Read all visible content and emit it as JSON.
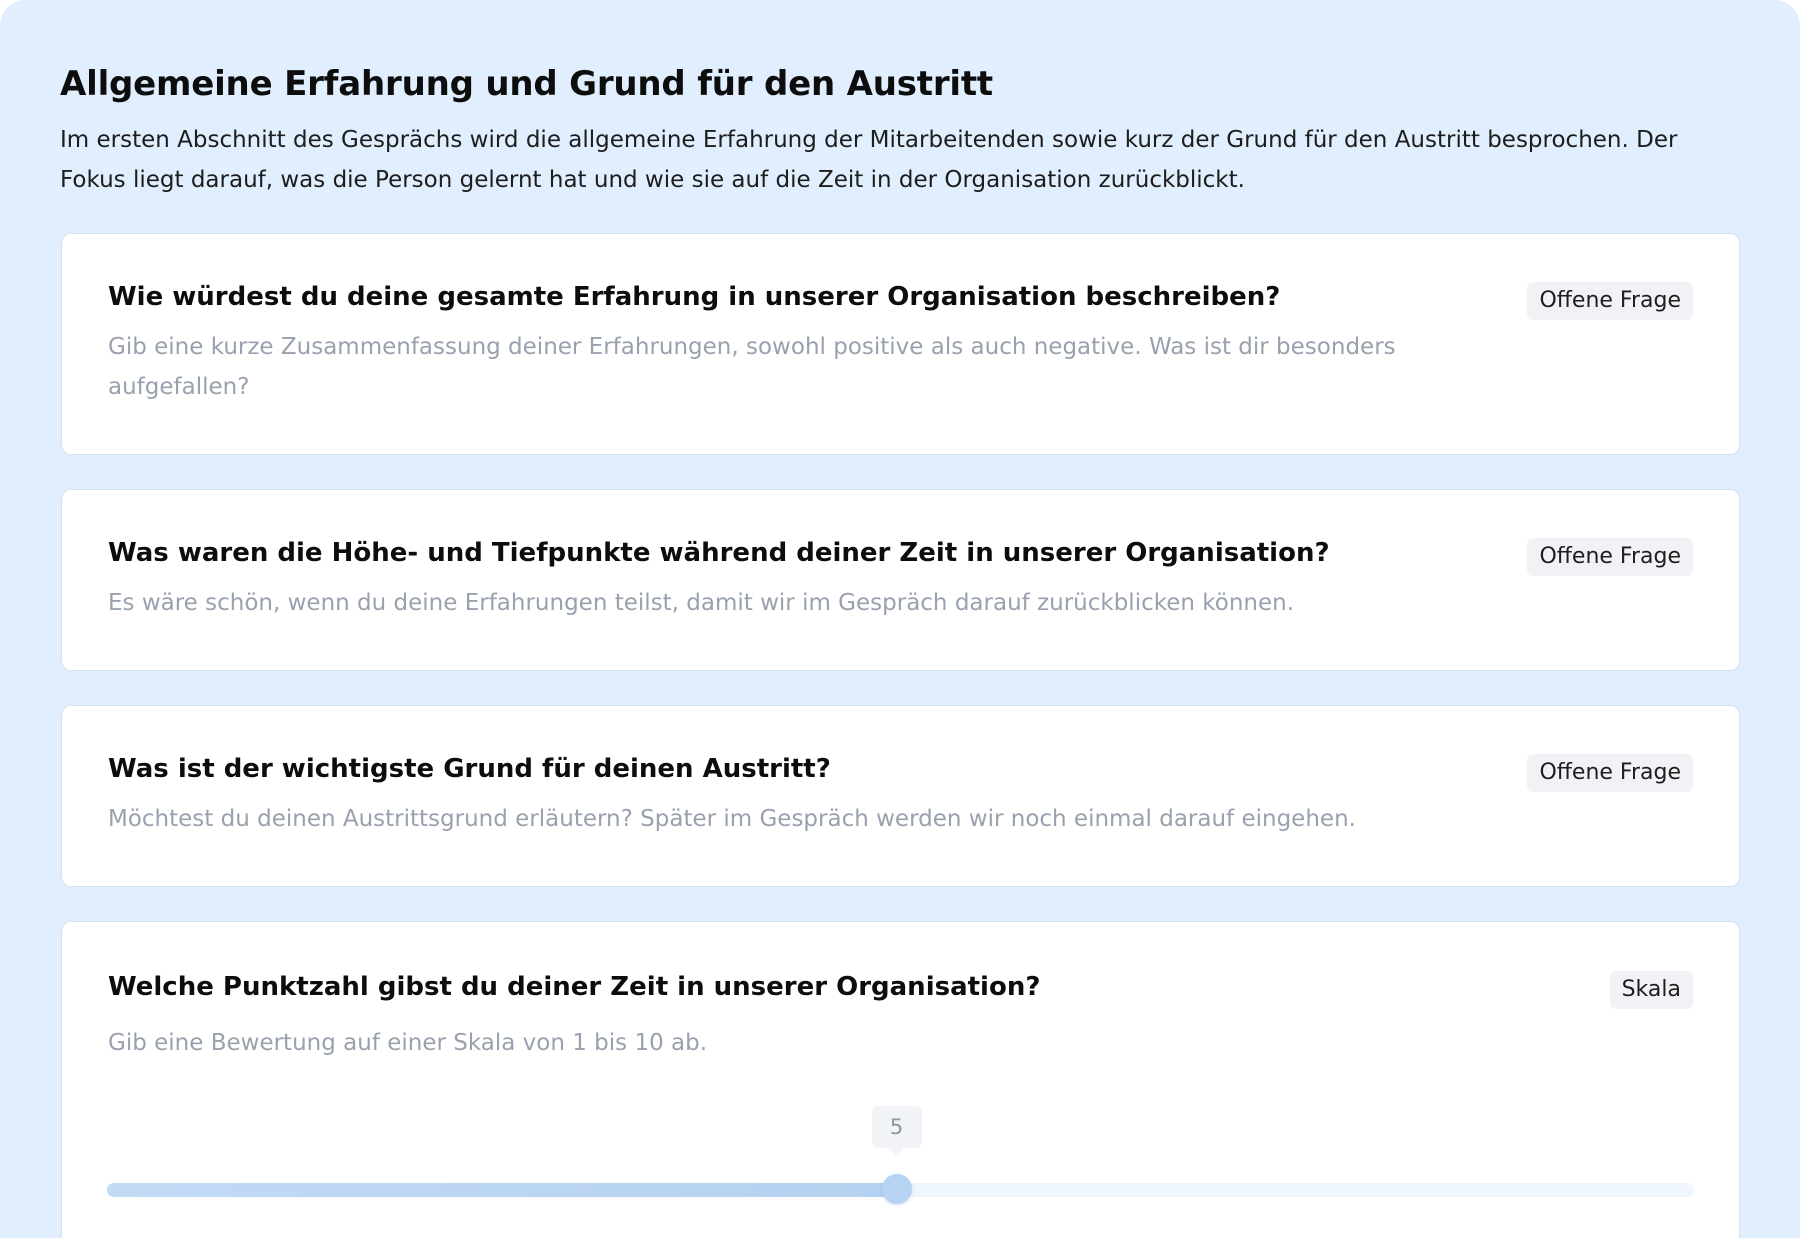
{
  "section": {
    "title": "Allgemeine Erfahrung und Grund für den Austritt",
    "description": "Im ersten Abschnitt des Gesprächs wird die allgemeine Erfahrung der Mitarbeitenden sowie kurz der Grund für den Austritt besprochen. Der Fokus liegt darauf, was die Person gelernt hat und wie sie auf die Zeit in der Organisation zurückblickt."
  },
  "questions": [
    {
      "title": "Wie würdest du deine gesamte Erfahrung in unserer Organisation beschreiben?",
      "hint": "Gib eine kurze Zusammenfassung deiner Erfahrungen, sowohl positive als auch negative. Was ist dir besonders aufgefallen?",
      "type": "Offene Frage"
    },
    {
      "title": "Was waren die Höhe- und Tiefpunkte während deiner Zeit in unserer Organisation?",
      "hint": "Es wäre schön, wenn du deine Erfahrungen teilst, damit wir im Gespräch darauf zurückblicken können.",
      "type": "Offene Frage"
    },
    {
      "title": "Was ist der wichtigste Grund für deinen Austritt?",
      "hint": "Möchtest du deinen Austrittsgrund erläutern? Später im Gespräch werden wir noch einmal darauf eingehen.",
      "type": "Offene Frage"
    },
    {
      "title": "Welche Punktzahl gibst du deiner Zeit in unserer Organisation?",
      "hint": "Gib eine Bewertung auf einer Skala von 1 bis 10 ab.",
      "type": "Skala",
      "scale": {
        "min": 1,
        "max": 10,
        "value": 5,
        "value_label": "5"
      }
    }
  ],
  "colors": {
    "background": "#e0eefd",
    "card": "#ffffff",
    "hint_text": "#99a1ae",
    "badge_bg": "#f0f2f5",
    "slider_fill": "#b7d3f2"
  }
}
